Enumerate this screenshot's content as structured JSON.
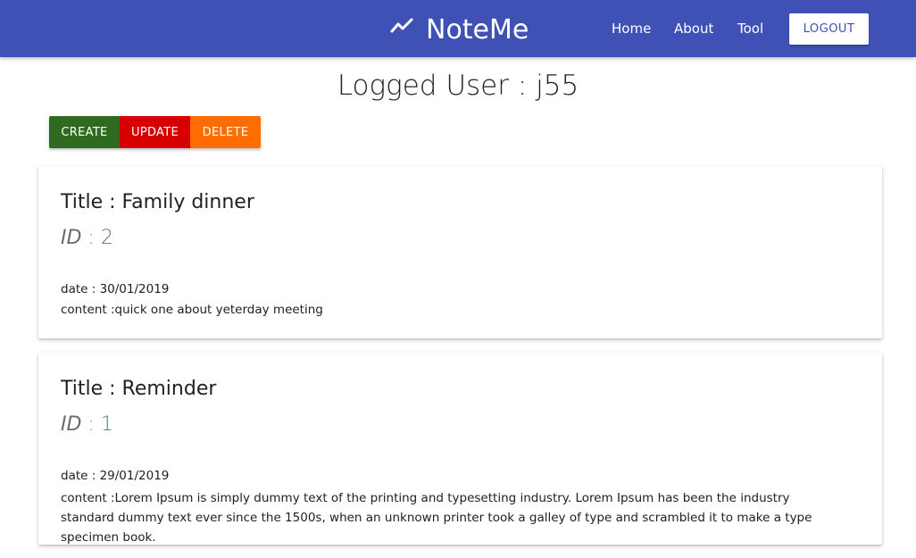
{
  "navbar": {
    "brand": "NoteMe",
    "brand_icon": "trending-up-icon",
    "links": [
      "Home",
      "About",
      "Tool"
    ],
    "logout_label": "LOGOUT"
  },
  "page": {
    "title": "Logged User : j55"
  },
  "actions": {
    "create_label": "CREATE",
    "update_label": "UPDATE",
    "delete_label": "DELETE"
  },
  "colors": {
    "navbar": "#3f51b5",
    "create": "#2e6b1e",
    "update": "#d60000",
    "delete": "#ff6d00"
  },
  "notes": [
    {
      "title": "Title : Family dinner",
      "id_label": "ID",
      "id_value": ": 2",
      "date": "date : 30/01/2019",
      "content": "content :quick one about yeterday meeting"
    },
    {
      "title": "Title : Reminder",
      "id_label": "ID",
      "id_value": ": 1",
      "date": "date : 29/01/2019",
      "content": "content :Lorem Ipsum is simply dummy text of the printing and typesetting industry. Lorem Ipsum has been the industry standard dummy text ever since the 1500s, when an unknown printer took a galley of type and scrambled it to make a type specimen book."
    }
  ]
}
